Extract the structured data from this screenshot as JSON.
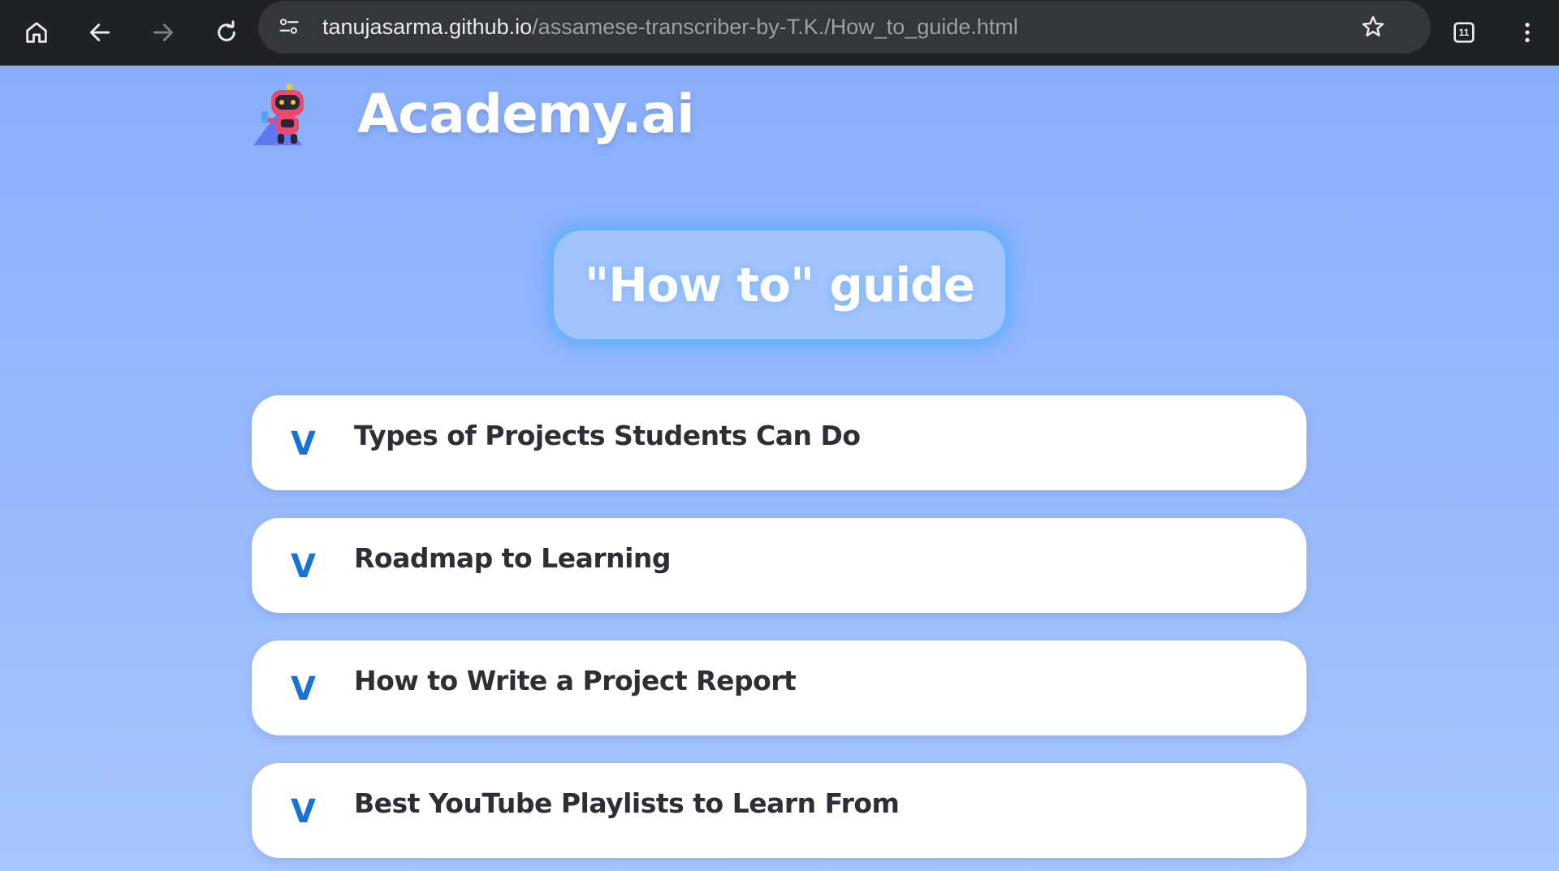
{
  "browser": {
    "url_host": "tanujasarma.github.io",
    "url_path": "/assamese-transcriber-by-T.K./How_to_guide.html",
    "tab_count": "11",
    "icons": {
      "home": "home-icon",
      "back": "arrow-left-icon",
      "forward": "arrow-right-icon",
      "reload": "reload-icon",
      "site_info": "tune-icon",
      "bookmark": "star-icon",
      "tabs": "tab-switcher-icon",
      "menu": "more-vert-icon"
    }
  },
  "header": {
    "title": "Academy.ai",
    "logo": "robot-logo"
  },
  "guide": {
    "title": "\"How to\" guide"
  },
  "sections": [
    {
      "toggle": "V",
      "label": "Types of Projects Students Can Do"
    },
    {
      "toggle": "V",
      "label": "Roadmap to Learning"
    },
    {
      "toggle": "V",
      "label": "How to Write a Project Report"
    },
    {
      "toggle": "V",
      "label": "Best YouTube Playlists to Learn From"
    }
  ],
  "colors": {
    "background_top": "#8aaefb",
    "background_bottom": "#a7c6fd",
    "accent": "#1873d6",
    "card_text": "#2d2f36",
    "pill_glow": "#50aaff"
  }
}
